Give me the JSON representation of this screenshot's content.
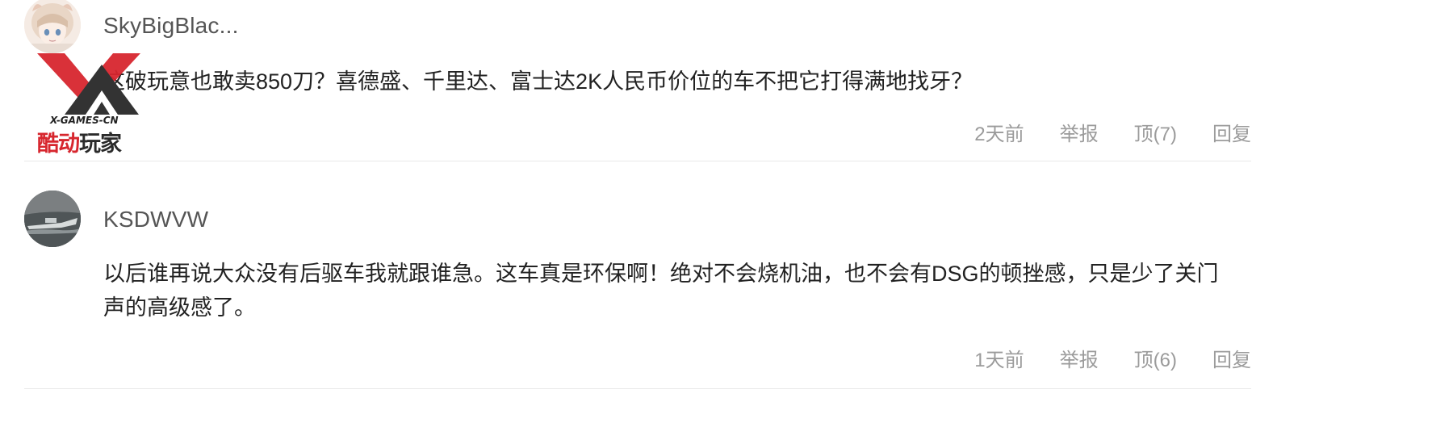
{
  "comments": [
    {
      "username": "SkyBigBlac...",
      "text": "这破玩意也敢卖850刀？喜德盛、千里达、富士达2K人民币价位的车不把它打得满地找牙？",
      "time": "2天前",
      "report_label": "举报",
      "upvote_label": "顶(7)",
      "reply_label": "回复",
      "avatar_icon": "anime-girl-avatar"
    },
    {
      "username": "KSDWVW",
      "text": "以后谁再说大众没有后驱车我就跟谁急。这车真是环保啊！绝对不会烧机油，也不会有DSG的顿挫感，只是少了关门声的高级感了。",
      "time": "1天前",
      "report_label": "举报",
      "upvote_label": "顶(6)",
      "reply_label": "回复",
      "avatar_icon": "boat-photo-avatar"
    }
  ],
  "watermark": {
    "text_en": "X-GAMES-CN",
    "text_cn_red": "酷动",
    "text_cn_dark": "玩家",
    "colors": {
      "red": "#d7262e",
      "dark": "#2a2a2a"
    }
  },
  "colors": {
    "text": "#222222",
    "username": "#555555",
    "meta": "#9b9b9b",
    "divider": "#e8e8e8"
  }
}
